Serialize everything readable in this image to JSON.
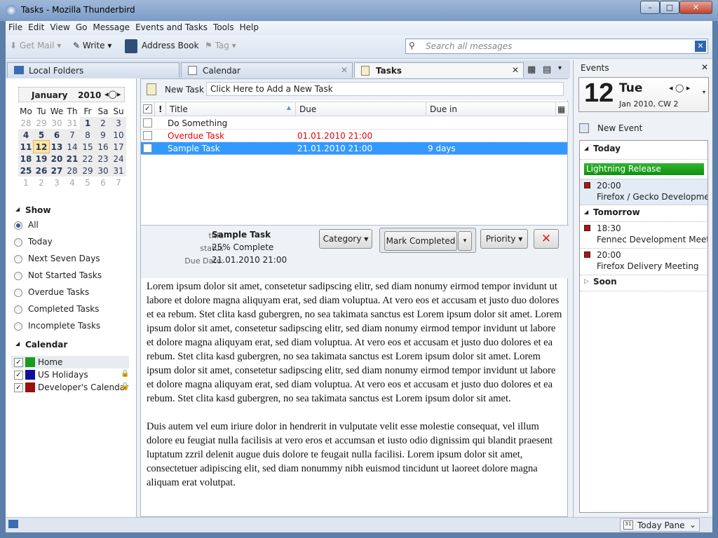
{
  "window": {
    "title": "Tasks - Mozilla Thunderbird"
  },
  "menu": [
    "File",
    "Edit",
    "View",
    "Go",
    "Message",
    "Events and Tasks",
    "Tools",
    "Help"
  ],
  "toolbar": {
    "get_mail": "Get Mail",
    "write": "Write",
    "address_book": "Address Book",
    "tag": "Tag",
    "search_placeholder": "Search all messages"
  },
  "tabs": [
    {
      "label": "Local Folders"
    },
    {
      "label": "Calendar"
    },
    {
      "label": "Tasks"
    }
  ],
  "minimonth": {
    "month": "January",
    "year": "2010",
    "weekdays": [
      "Mo",
      "Tu",
      "We",
      "Th",
      "Fr",
      "Sa",
      "Su"
    ],
    "weeks": [
      [
        "28",
        "29",
        "30",
        "31",
        "1",
        "2",
        "3"
      ],
      [
        "4",
        "5",
        "6",
        "7",
        "8",
        "9",
        "10"
      ],
      [
        "11",
        "12",
        "13",
        "14",
        "15",
        "16",
        "17"
      ],
      [
        "18",
        "19",
        "20",
        "21",
        "22",
        "23",
        "24"
      ],
      [
        "25",
        "26",
        "27",
        "28",
        "29",
        "30",
        "31"
      ],
      [
        "1",
        "2",
        "3",
        "4",
        "5",
        "6",
        "7"
      ]
    ]
  },
  "show": {
    "title": "Show",
    "options": [
      "All",
      "Today",
      "Next Seven Days",
      "Not Started Tasks",
      "Overdue Tasks",
      "Completed Tasks",
      "Incomplete Tasks"
    ],
    "selected": "All"
  },
  "calendars": {
    "title": "Calendar",
    "items": [
      {
        "name": "Home",
        "color": "#1a9b1a",
        "locked": false
      },
      {
        "name": "US Holidays",
        "color": "#1010a0",
        "locked": true
      },
      {
        "name": "Developer's Calendar",
        "color": "#9b1010",
        "locked": true
      }
    ]
  },
  "newtask": {
    "label": "New Task",
    "placeholder": "Click Here to Add a New Task"
  },
  "task_columns": [
    "Title",
    "Due",
    "Due in"
  ],
  "tasks": [
    {
      "title": "Do Something",
      "due": "",
      "due_in": "",
      "state": "normal"
    },
    {
      "title": "Overdue Task",
      "due": "01.01.2010 21:00",
      "due_in": "",
      "state": "overdue"
    },
    {
      "title": "Sample Task",
      "due": "21.01.2010 21:00",
      "due_in": "9 days",
      "state": "selected"
    }
  ],
  "details": {
    "title_label": "title",
    "title": "Sample Task",
    "status_label": "status",
    "status": "25% Complete",
    "due_label": "Due Date:",
    "due": "21.01.2010 21:00",
    "category": "Category",
    "mark_completed": "Mark Completed",
    "priority": "Priority"
  },
  "description": [
    "Lorem ipsum dolor sit amet, consetetur sadipscing elitr, sed diam nonumy eirmod tempor invidunt ut labore et dolore magna aliquyam erat, sed diam voluptua. At vero eos et accusam et justo duo dolores et ea rebum. Stet clita kasd gubergren, no sea takimata sanctus est Lorem ipsum dolor sit amet. Lorem ipsum dolor sit amet, consetetur sadipscing elitr, sed diam nonumy eirmod tempor invidunt ut labore et dolore magna aliquyam erat, sed diam voluptua. At vero eos et accusam et justo duo dolores et ea rebum. Stet clita kasd gubergren, no sea takimata sanctus est Lorem ipsum dolor sit amet. Lorem ipsum dolor sit amet, consetetur sadipscing elitr, sed diam nonumy eirmod tempor invidunt ut labore et dolore magna aliquyam erat, sed diam voluptua. At vero eos et accusam et justo duo dolores et ea rebum. Stet clita kasd gubergren, no sea takimata sanctus est Lorem ipsum dolor sit amet.",
    "Duis autem vel eum iriure dolor in hendrerit in vulputate velit esse molestie consequat, vel illum dolore eu feugiat nulla facilisis at vero eros et accumsan et iusto odio dignissim qui blandit praesent luptatum zzril delenit augue duis dolore te feugait nulla facilisi. Lorem ipsum dolor sit amet, consectetuer adipiscing elit, sed diam nonummy nibh euismod tincidunt ut laoreet dolore magna aliquam erat volutpat."
  ],
  "events_pane": {
    "title": "Events",
    "day": "12",
    "weekday": "Tue",
    "month_week": "Jan 2010, CW 2",
    "new_event": "New Event",
    "today": "Today",
    "allday": "Lightning Release",
    "today_events": [
      {
        "time": "20:00",
        "title": "Firefox / Gecko Development Meeting"
      }
    ],
    "tomorrow": "Tomorrow",
    "tomorrow_events": [
      {
        "time": "18:30",
        "title": "Fennec Development Meeting"
      },
      {
        "time": "20:00",
        "title": "Firefox Delivery Meeting"
      }
    ],
    "soon": "Soon"
  },
  "status": {
    "today_pane": "Today Pane"
  }
}
